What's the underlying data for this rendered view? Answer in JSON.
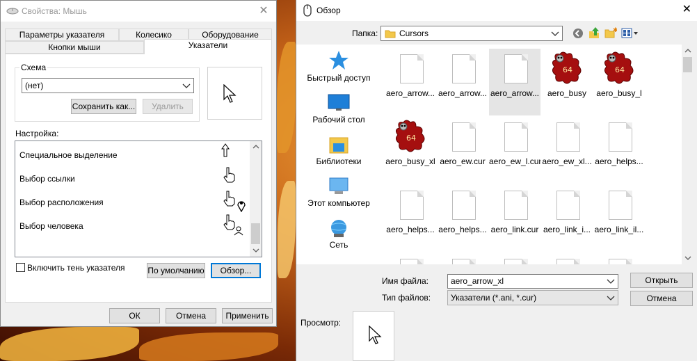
{
  "mouse_props": {
    "title": "Свойства: Мышь",
    "tabs_row1": [
      "Параметры указателя",
      "Колесико",
      "Оборудование"
    ],
    "tabs_row2": [
      "Кнопки мыши",
      "Указатели"
    ],
    "scheme_label": "Схема",
    "scheme_value": "(нет)",
    "save_as_label": "Сохранить как...",
    "delete_label": "Удалить",
    "customize_label": "Настройка:",
    "cursor_list": [
      "Специальное выделение",
      "Выбор ссылки",
      "Выбор расположения",
      "Выбор человека"
    ],
    "shadow_checkbox_label": "Включить тень указателя",
    "shadow_checked": false,
    "default_label": "По умолчанию",
    "browse_label": "Обзор...",
    "ok_label": "ОК",
    "cancel_label": "Отмена",
    "apply_label": "Применить"
  },
  "browse": {
    "title": "Обзор",
    "folder_label": "Папка:",
    "folder_value": "Cursors",
    "nav_items": [
      "Быстрый доступ",
      "Рабочий стол",
      "Библиотеки",
      "Этот компьютер",
      "Сеть"
    ],
    "files": [
      {
        "name": "aero_arrow...",
        "kind": "doc"
      },
      {
        "name": "aero_arrow...",
        "kind": "doc"
      },
      {
        "name": "aero_arrow...",
        "kind": "doc",
        "selected": true
      },
      {
        "name": "aero_busy",
        "kind": "busy"
      },
      {
        "name": "aero_busy_l",
        "kind": "busy"
      },
      {
        "name": "aero_busy_xl",
        "kind": "busy"
      },
      {
        "name": "aero_ew.cur",
        "kind": "doc"
      },
      {
        "name": "aero_ew_l.cur",
        "kind": "doc"
      },
      {
        "name": "aero_ew_xl...",
        "kind": "doc"
      },
      {
        "name": "aero_helps...",
        "kind": "doc"
      },
      {
        "name": "aero_helps...",
        "kind": "doc"
      },
      {
        "name": "aero_helps...",
        "kind": "doc"
      },
      {
        "name": "aero_link.cur",
        "kind": "doc"
      },
      {
        "name": "aero_link_i...",
        "kind": "doc"
      },
      {
        "name": "aero_link_il...",
        "kind": "doc"
      }
    ],
    "busy_badge": "64",
    "filename_label": "Имя файла:",
    "filename_value": "aero_arrow_xl",
    "filetype_label": "Тип файлов:",
    "filetype_value": "Указатели (*.ani, *.cur)",
    "open_label": "Открыть",
    "cancel_label": "Отмена",
    "preview_label": "Просмотр:"
  },
  "colors": {
    "accent": "#0078d7",
    "star": "#2b8fe0",
    "busy": "#a50f0f"
  }
}
